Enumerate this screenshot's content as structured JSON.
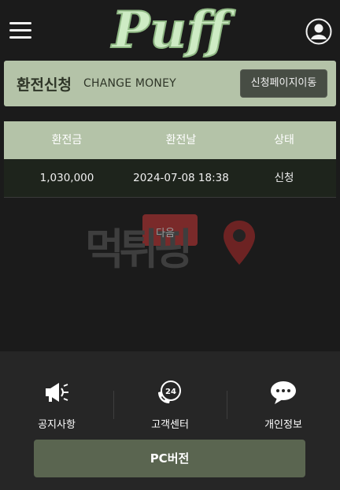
{
  "header": {
    "logo_text": "Puff"
  },
  "title_bar": {
    "title": "환전신청",
    "subtitle": "CHANGE MONEY",
    "move_button": "신청페이지이동"
  },
  "table": {
    "columns": [
      "환전금",
      "환전날",
      "상태"
    ],
    "rows": [
      {
        "amount": "1,030,000",
        "date": "2024-07-08 18:38",
        "status": "신청"
      }
    ]
  },
  "watermark": {
    "text": "먹튀핑",
    "badge_label": "다음"
  },
  "bottom_nav": {
    "items": [
      {
        "label": "공지사항",
        "icon": "megaphone-icon"
      },
      {
        "label": "고객센터",
        "icon": "phone-24-icon"
      },
      {
        "label": "개인정보",
        "icon": "chat-icon"
      }
    ],
    "pc_button": "PC버전"
  },
  "colors": {
    "accent": "#b4c3a8",
    "button_dark": "#474d44",
    "pc_button": "#5a6550"
  }
}
